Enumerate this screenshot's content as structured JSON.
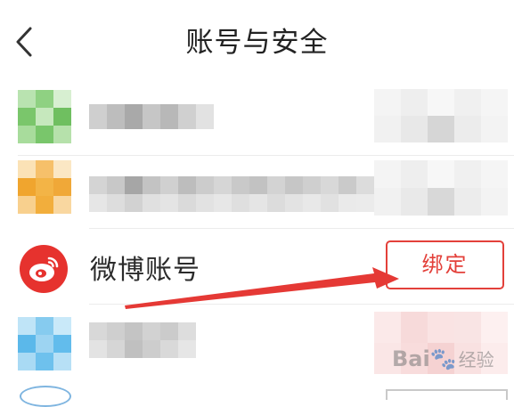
{
  "header": {
    "title": "账号与安全",
    "back_icon": "chevron-left-icon"
  },
  "weibo": {
    "label": "微博账号",
    "icon": "weibo-icon",
    "button_label": "绑定",
    "accent": "#e3403a"
  },
  "watermark": {
    "brand": "Bai",
    "suffix": "经验"
  },
  "colors": {
    "wechat_green": "#7bc96f",
    "qq_orange": "#f0a52e",
    "blue": "#5bb8ea",
    "arrow_red": "#e53935"
  }
}
